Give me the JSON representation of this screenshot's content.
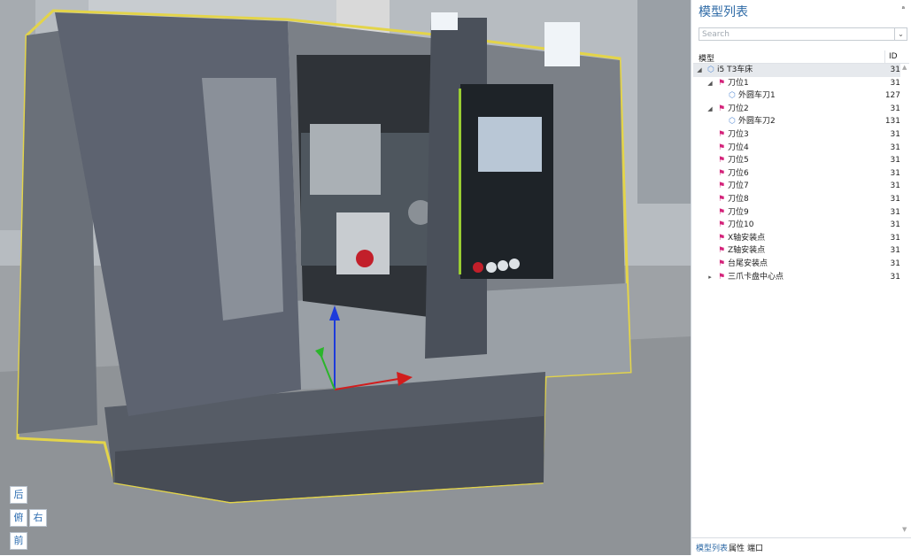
{
  "view_controls": {
    "back": "后",
    "top": "俯",
    "right": "右",
    "front": "前"
  },
  "panel": {
    "title": "模型列表",
    "pin_icon": "pin-icon",
    "search_placeholder": "Search",
    "header": {
      "model": "模型",
      "id": "ID"
    },
    "tree": [
      {
        "label": "i5 T3车床",
        "id": "31",
        "level": 0,
        "icon": "cube",
        "expanded": true,
        "selected": true
      },
      {
        "label": "刀位1",
        "id": "31",
        "level": 1,
        "icon": "flag",
        "expanded": true
      },
      {
        "label": "外圆车刀1",
        "id": "127",
        "level": 2,
        "icon": "cube"
      },
      {
        "label": "刀位2",
        "id": "31",
        "level": 1,
        "icon": "flag",
        "expanded": true
      },
      {
        "label": "外圆车刀2",
        "id": "131",
        "level": 2,
        "icon": "cube"
      },
      {
        "label": "刀位3",
        "id": "31",
        "level": 1,
        "icon": "flag"
      },
      {
        "label": "刀位4",
        "id": "31",
        "level": 1,
        "icon": "flag"
      },
      {
        "label": "刀位5",
        "id": "31",
        "level": 1,
        "icon": "flag"
      },
      {
        "label": "刀位6",
        "id": "31",
        "level": 1,
        "icon": "flag"
      },
      {
        "label": "刀位7",
        "id": "31",
        "level": 1,
        "icon": "flag"
      },
      {
        "label": "刀位8",
        "id": "31",
        "level": 1,
        "icon": "flag"
      },
      {
        "label": "刀位9",
        "id": "31",
        "level": 1,
        "icon": "flag"
      },
      {
        "label": "刀位10",
        "id": "31",
        "level": 1,
        "icon": "flag"
      },
      {
        "label": "X轴安装点",
        "id": "31",
        "level": 1,
        "icon": "flag"
      },
      {
        "label": "Z轴安装点",
        "id": "31",
        "level": 1,
        "icon": "flag"
      },
      {
        "label": "台尾安装点",
        "id": "31",
        "level": 1,
        "icon": "flag"
      },
      {
        "label": "三爪卡盘中心点",
        "id": "31",
        "level": 1,
        "icon": "flag",
        "collapsed": true
      }
    ],
    "tabs": [
      "模型列表",
      "属性",
      "端口"
    ]
  },
  "colors": {
    "accent": "#2e6aa6",
    "flag": "#d4237a",
    "cube": "#5b8fd6",
    "highlight": "#e3d44a"
  }
}
